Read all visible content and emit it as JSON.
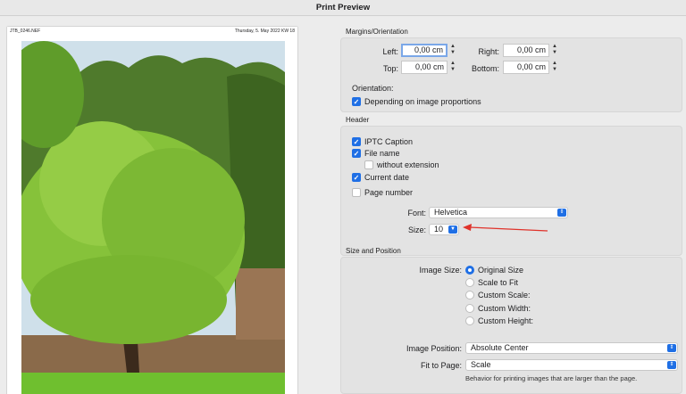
{
  "window": {
    "title": "Print Preview"
  },
  "preview": {
    "file_name": "JTB_0246.NEF",
    "date_text": "Thursday, 5. May 2022 KW 18"
  },
  "margins": {
    "section_title": "Margins/Orientation",
    "left_label": "Left:",
    "left_value": "0,00 cm",
    "right_label": "Right:",
    "right_value": "0,00 cm",
    "top_label": "Top:",
    "top_value": "0,00 cm",
    "bottom_label": "Bottom:",
    "bottom_value": "0,00 cm",
    "orientation_label": "Orientation:",
    "depending_label": "Depending on image proportions",
    "depending_checked": true
  },
  "header": {
    "section_title": "Header",
    "iptc_label": "IPTC Caption",
    "iptc_checked": true,
    "filename_label": "File name",
    "filename_checked": true,
    "without_ext_label": "without extension",
    "without_ext_checked": false,
    "current_date_label": "Current date",
    "current_date_checked": true,
    "page_number_label": "Page number",
    "page_number_checked": false,
    "font_label": "Font:",
    "font_value": "Helvetica",
    "size_label": "Size:",
    "size_value": "10"
  },
  "size_position": {
    "section_title": "Size and Position",
    "image_size_label": "Image Size:",
    "options": [
      "Original Size",
      "Scale to Fit",
      "Custom Scale:",
      "Custom Width:",
      "Custom Height:"
    ],
    "selected_option": "Original Size",
    "image_position_label": "Image Position:",
    "image_position_value": "Absolute Center",
    "fit_to_page_label": "Fit to Page:",
    "fit_to_page_value": "Scale",
    "fit_note": "Behavior for printing images that are larger than the page."
  },
  "colors": {
    "accent": "#1f6fe5",
    "annotation_arrow": "#e0322a"
  }
}
